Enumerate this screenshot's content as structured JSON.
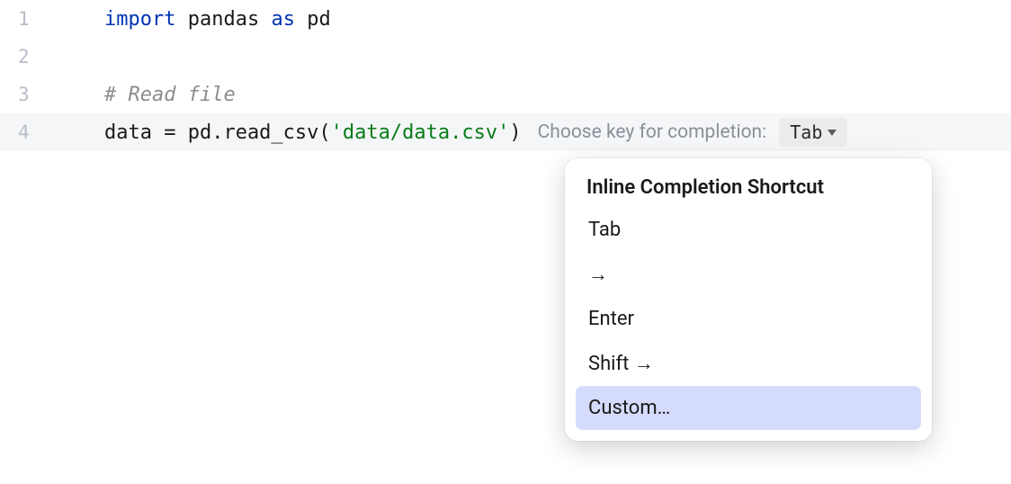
{
  "code": {
    "lines": [
      {
        "num": "1",
        "tokens": [
          {
            "cls": "kw",
            "t": "import"
          },
          {
            "cls": "plain",
            "t": " pandas "
          },
          {
            "cls": "kw",
            "t": "as"
          },
          {
            "cls": "plain",
            "t": " pd"
          }
        ]
      },
      {
        "num": "2",
        "tokens": []
      },
      {
        "num": "3",
        "tokens": [
          {
            "cls": "comment",
            "t": "# Read file"
          }
        ]
      },
      {
        "num": "4",
        "highlighted": true,
        "tokens": [
          {
            "cls": "plain",
            "t": "data = pd.read_csv("
          },
          {
            "cls": "string",
            "t": "'data/data.csv'"
          },
          {
            "cls": "plain",
            "t": ")"
          }
        ]
      }
    ]
  },
  "completion": {
    "hint": "Choose key for completion:",
    "selected_key": "Tab"
  },
  "popup": {
    "title": "Inline Completion Shortcut",
    "items": [
      {
        "label": "Tab",
        "selected": false
      },
      {
        "label": "→",
        "selected": false
      },
      {
        "label": "Enter",
        "selected": false
      },
      {
        "label": "Shift →",
        "selected": false
      },
      {
        "label": "Custom…",
        "selected": true
      }
    ]
  }
}
